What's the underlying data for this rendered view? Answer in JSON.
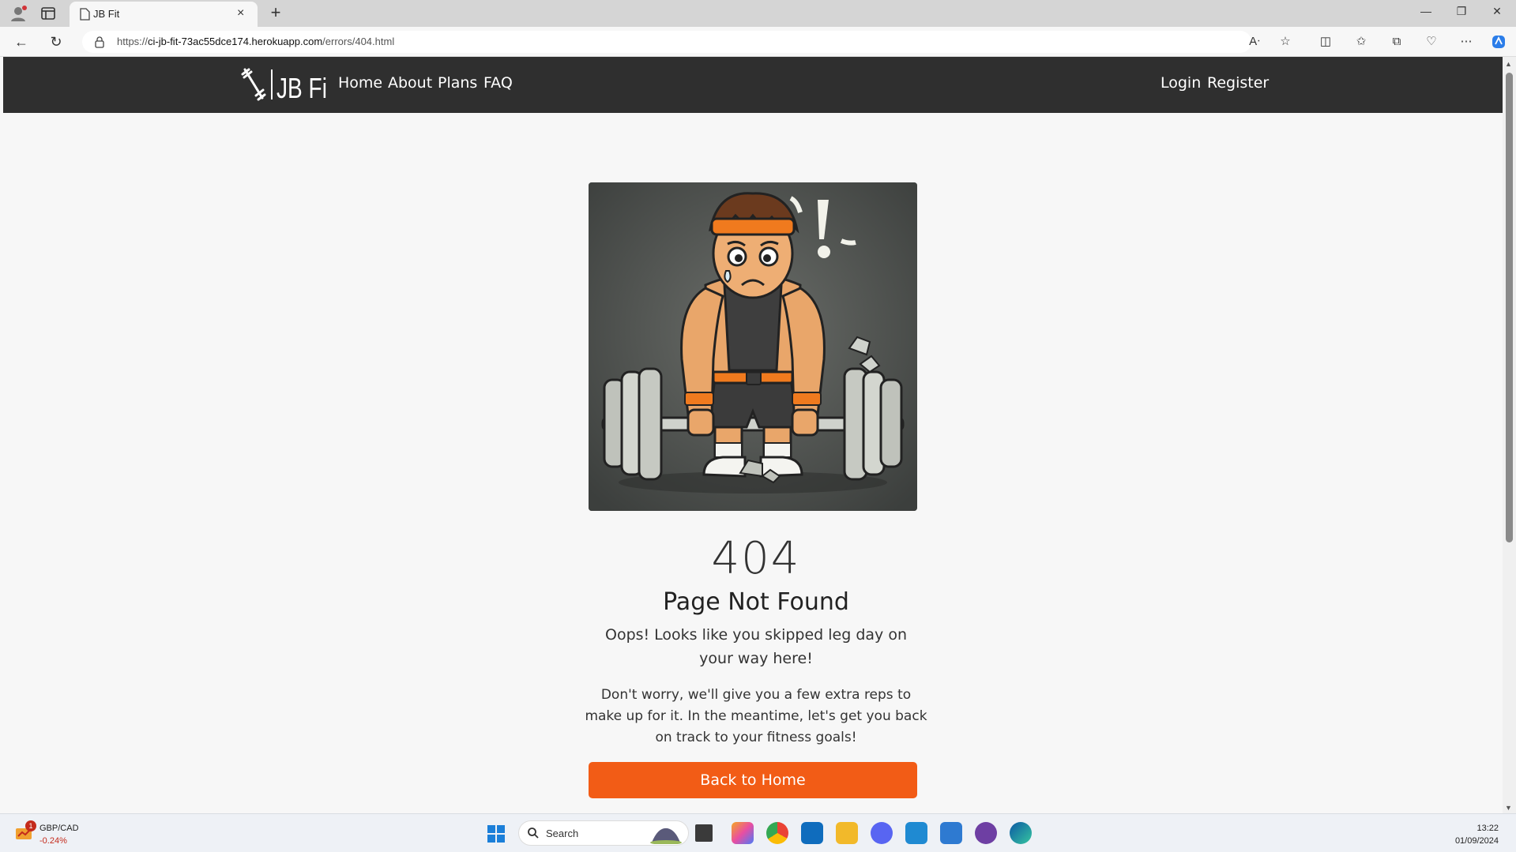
{
  "browser": {
    "tab_title": "JB Fit",
    "url_prefix": "https://",
    "url_host": "ci-jb-fit-73ac55dce174.herokuapp.com",
    "url_path": "/errors/404.html"
  },
  "site": {
    "logo_text": "JB Fit",
    "nav_left": [
      "Home",
      "About",
      "Plans",
      "FAQ"
    ],
    "nav_right": [
      "Login",
      "Register"
    ]
  },
  "error": {
    "code": "404",
    "title": "Page Not Found",
    "lead": "Oops! Looks like you skipped leg day on your way here!",
    "body": "Don't worry, we'll give you a few extra reps to make up for it. In the meantime, let's get you back on track to your fitness goals!",
    "button": "Back to Home"
  },
  "taskbar": {
    "widget_pair": "GBP/CAD",
    "widget_change": "-0.24%",
    "widget_badge": "1",
    "search_label": "Search",
    "time": "13:22",
    "date": "01/09/2024"
  },
  "colors": {
    "navbar": "#2f2f2f",
    "cta": "#f25c16",
    "page_bg": "#f7f7f7"
  }
}
